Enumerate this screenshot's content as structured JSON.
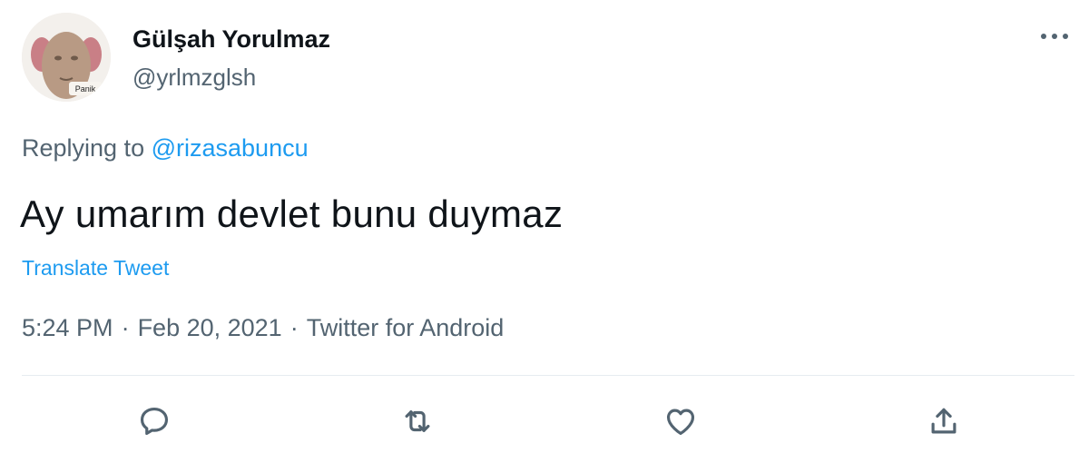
{
  "user": {
    "display_name": "Gülşah Yorulmaz",
    "handle": "@yrlmzglsh",
    "avatar_caption": "Panik"
  },
  "reply": {
    "prefix": "Replying to",
    "mention": "@rizasabuncu"
  },
  "tweet": {
    "text": "Ay umarım devlet bunu duymaz",
    "translate_label": "Translate Tweet",
    "time": "5:24 PM",
    "date": "Feb 20, 2021",
    "separator": "·",
    "source": "Twitter for Android"
  },
  "actions": {
    "icons": [
      "reply-icon",
      "retweet-icon",
      "like-icon",
      "share-icon"
    ]
  },
  "colors": {
    "accent": "#1d9bf0",
    "secondary_text": "#536471",
    "primary_text": "#0f1419"
  }
}
